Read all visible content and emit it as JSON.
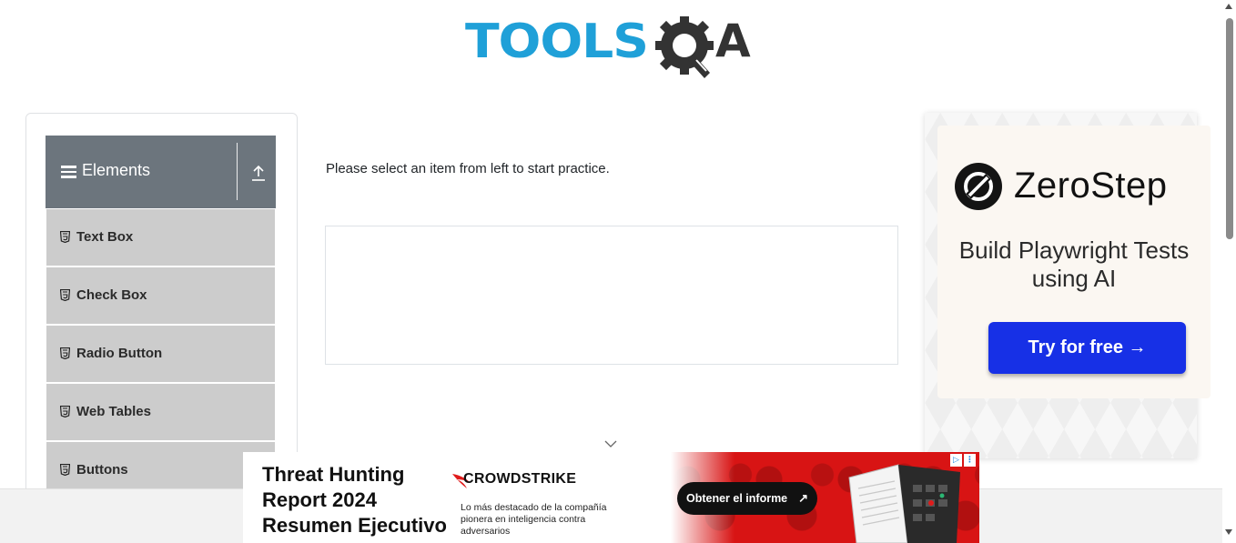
{
  "header": {
    "logo_text_left": "TOOLS",
    "logo_text_right": "A",
    "colors": {
      "tools": "#1fa0d8",
      "qa": "#333333"
    }
  },
  "sidebar": {
    "group": {
      "title": "Elements",
      "icons": [
        "menu-icon",
        "upload-icon"
      ],
      "header_color": "#6c757d"
    },
    "items": [
      {
        "label": "Text Box",
        "icon": "html5-icon"
      },
      {
        "label": "Check Box",
        "icon": "html5-icon"
      },
      {
        "label": "Radio Button",
        "icon": "html5-icon"
      },
      {
        "label": "Web Tables",
        "icon": "html5-icon"
      },
      {
        "label": "Buttons",
        "icon": "html5-icon"
      }
    ],
    "item_color": "#cccccc"
  },
  "main": {
    "instructions": "Please select an item from left to start practice."
  },
  "side_ad": {
    "brand": "ZeroStep",
    "tagline": "Build Playwright Tests using AI",
    "cta": "Try for free →",
    "cta_color": "#1730e6"
  },
  "banner_ad": {
    "headline": "Threat Hunting Report 2024 Resumen Ejecutivo",
    "brand": "CROWDSTRIKE",
    "subtext": "Lo más destacado de la compañía pionera en inteligencia contra adversarios",
    "cta": "Obtener el informe",
    "cta_arrow": "↗",
    "background_color": "#d81414"
  }
}
